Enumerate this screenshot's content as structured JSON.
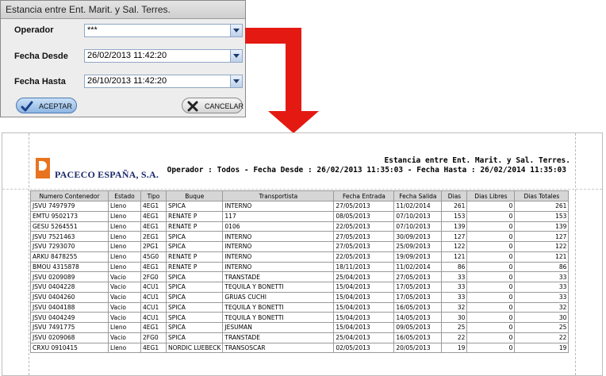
{
  "dialog": {
    "title": "Estancia entre Ent. Marit. y Sal. Terres.",
    "fields": [
      {
        "label": "Operador",
        "value": "***"
      },
      {
        "label": "Fecha Desde",
        "value": "26/02/2013 11:42:20"
      },
      {
        "label": "Fecha Hasta",
        "value": "26/10/2013 11:42:20"
      }
    ],
    "accept_label": "ACEPTAR",
    "cancel_label": "CANCELAR"
  },
  "colors": {
    "arrow": "#e41a12",
    "accent": "#4d79b1"
  },
  "report": {
    "company": "PACECO ESPAÑA, S.A.",
    "title": "Estancia entre Ent. Marit. y Sal. Terres.",
    "subtitle": "Operador : Todos - Fecha Desde : 26/02/2013 11:35:03 - Fecha Hasta : 26/02/2014 11:35:03",
    "columns": [
      "Numero Contenedor",
      "Estado",
      "Tipo",
      "Buque",
      "Transportista",
      "Fecha Entrada",
      "Fecha Salida",
      "Dias",
      "Dias Libres",
      "Dias Totales"
    ],
    "rows": [
      [
        "JSVU 7497979",
        "Lleno",
        "4EG1",
        "SPICA",
        "INTERNO",
        "27/05/2013",
        "11/02/2014",
        "261",
        "0",
        "261"
      ],
      [
        "EMTU 9502173",
        "Lleno",
        "4EG1",
        "RENATE P",
        "117",
        "08/05/2013",
        "07/10/2013",
        "153",
        "0",
        "153"
      ],
      [
        "GESU 5264551",
        "Lleno",
        "4EG1",
        "RENATE P",
        "0106",
        "22/05/2013",
        "07/10/2013",
        "139",
        "0",
        "139"
      ],
      [
        "JSVU 7521463",
        "Lleno",
        "2EG1",
        "SPICA",
        "INTERNO",
        "27/05/2013",
        "30/09/2013",
        "127",
        "0",
        "127"
      ],
      [
        "JSVU 7293070",
        "Lleno",
        "2PG1",
        "SPICA",
        "INTERNO",
        "27/05/2013",
        "25/09/2013",
        "122",
        "0",
        "122"
      ],
      [
        "ARKU 8478255",
        "Lleno",
        "45G0",
        "RENATE P",
        "INTERNO",
        "22/05/2013",
        "19/09/2013",
        "121",
        "0",
        "121"
      ],
      [
        "BMOU 4315878",
        "Lleno",
        "4EG1",
        "RENATE P",
        "INTERNO",
        "18/11/2013",
        "11/02/2014",
        "86",
        "0",
        "86"
      ],
      [
        "JSVU 0209089",
        "Vacio",
        "2FG0",
        "SPICA",
        "TRANSTADE",
        "25/04/2013",
        "27/05/2013",
        "33",
        "0",
        "33"
      ],
      [
        "JSVU 0404228",
        "Vacio",
        "4CU1",
        "SPICA",
        "TEQUILA Y BONETTI",
        "15/04/2013",
        "17/05/2013",
        "33",
        "0",
        "33"
      ],
      [
        "JSVU 0404260",
        "Vacio",
        "4CU1",
        "SPICA",
        "GRUAS CUCHI",
        "15/04/2013",
        "17/05/2013",
        "33",
        "0",
        "33"
      ],
      [
        "JSVU 0404188",
        "Vacio",
        "4CU1",
        "SPICA",
        "TEQUILA Y BONETTI",
        "15/04/2013",
        "16/05/2013",
        "32",
        "0",
        "32"
      ],
      [
        "JSVU 0404249",
        "Vacio",
        "4CU1",
        "SPICA",
        "TEQUILA Y BONETTI",
        "15/04/2013",
        "14/05/2013",
        "30",
        "0",
        "30"
      ],
      [
        "JSVU 7491775",
        "Lleno",
        "4EG1",
        "SPICA",
        "JESUMAN",
        "15/04/2013",
        "09/05/2013",
        "25",
        "0",
        "25"
      ],
      [
        "JSVU 0209068",
        "Vacio",
        "2FG0",
        "SPICA",
        "TRANSTADE",
        "25/04/2013",
        "16/05/2013",
        "22",
        "0",
        "22"
      ],
      [
        "CRXU 0910415",
        "Lleno",
        "4EG1",
        "NORDIC LUEBECK",
        "TRANSOSCAR",
        "02/05/2013",
        "20/05/2013",
        "19",
        "0",
        "19"
      ]
    ]
  }
}
